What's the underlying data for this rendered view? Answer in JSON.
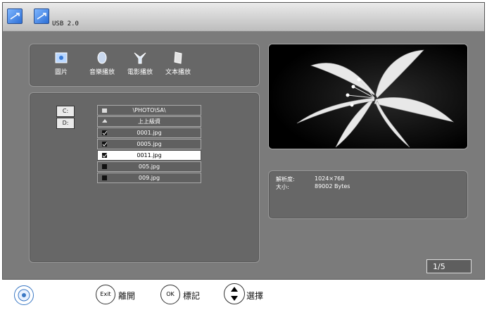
{
  "header": {
    "title": "USB 2.0",
    "icons": [
      "usb-icon",
      "usb-icon"
    ]
  },
  "categories": [
    {
      "label": "圖片",
      "icon": "photo-icon"
    },
    {
      "label": "音樂播放",
      "icon": "music-icon"
    },
    {
      "label": "電影播放",
      "icon": "movie-icon"
    },
    {
      "label": "文本播放",
      "icon": "text-icon"
    }
  ],
  "side_buttons": [
    {
      "label": "C:"
    },
    {
      "label": "D:"
    }
  ],
  "file_list": [
    {
      "name": "\\PHOTO\\SA\\",
      "icon": "folder-icon",
      "selected": false
    },
    {
      "name": "上上級資",
      "icon": "up-icon",
      "selected": false
    },
    {
      "name": "0001.jpg",
      "icon": "check-icon",
      "selected": false
    },
    {
      "name": "0005.jpg",
      "icon": "check-icon",
      "selected": false
    },
    {
      "name": "0011.jpg",
      "icon": "check-icon",
      "selected": true
    },
    {
      "name": "005.jpg",
      "icon": "square-icon",
      "selected": false
    },
    {
      "name": "009.jpg",
      "icon": "square-icon",
      "selected": false
    }
  ],
  "info": {
    "resolution_label": "解析度:",
    "resolution_value": "1024×768",
    "size_label": "大小:",
    "size_value": "89002 Bytes"
  },
  "page_indicator": "1/5",
  "footer": {
    "exit_key": "Exit",
    "exit_label": "離開",
    "ok_key": "OK",
    "ok_label": "標記",
    "select_label": "選擇"
  },
  "colors": {
    "background": "#7b7b7b",
    "panel": "#676767",
    "selected_row": "#ffffff",
    "accent_icon": "#2c6ed6"
  }
}
